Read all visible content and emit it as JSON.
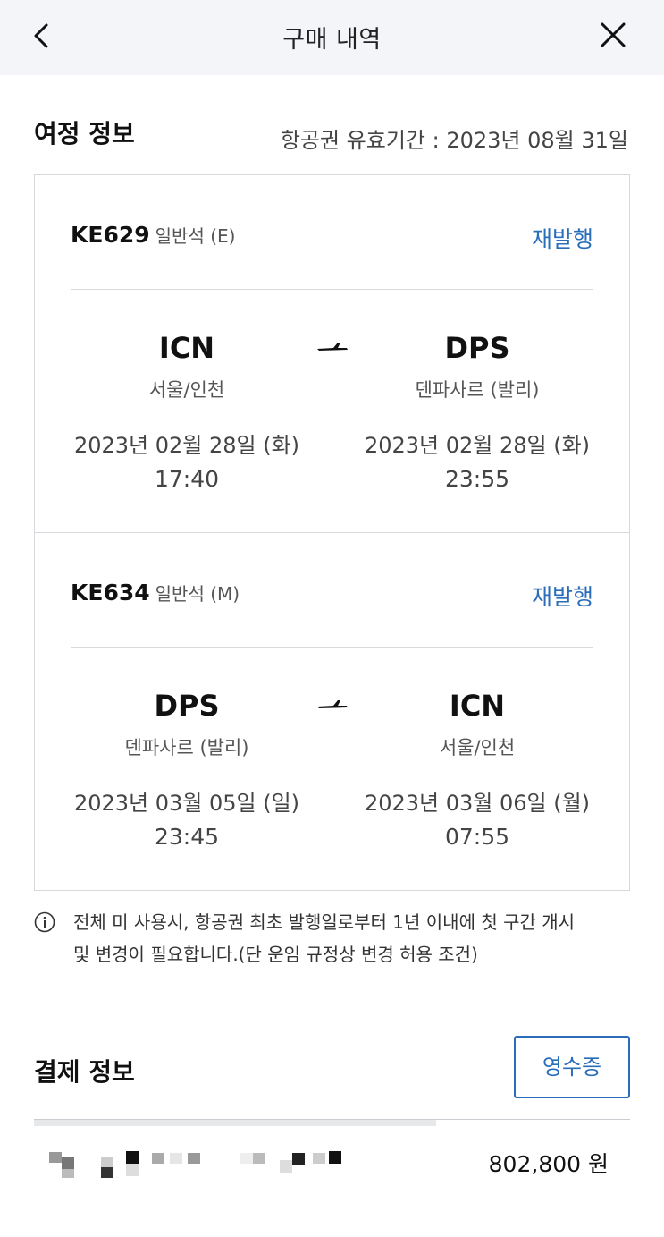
{
  "header": {
    "title": "구매 내역",
    "back_icon": "chevron-left-icon",
    "close_icon": "close-icon"
  },
  "itinerary": {
    "section_title": "여정 정보",
    "validity": "항공권 유효기간 : 2023년 08월 31일",
    "flights": [
      {
        "flight_no": "KE629",
        "cabin": "일반석 (E)",
        "reissue_label": "재발행",
        "departure": {
          "code": "ICN",
          "city": "서울/인천",
          "date": "2023년 02월 28일 (화)",
          "time": "17:40"
        },
        "arrival": {
          "code": "DPS",
          "city": "덴파사르 (발리)",
          "date": "2023년 02월 28일 (화)",
          "time": "23:55"
        }
      },
      {
        "flight_no": "KE634",
        "cabin": "일반석 (M)",
        "reissue_label": "재발행",
        "departure": {
          "code": "DPS",
          "city": "덴파사르 (발리)",
          "date": "2023년 03월 05일 (일)",
          "time": "23:45"
        },
        "arrival": {
          "code": "ICN",
          "city": "서울/인천",
          "date": "2023년 03월 06일 (월)",
          "time": "07:55"
        }
      }
    ],
    "notice_line1": "전체 미 사용시, 항공권 최초 발행일로부터 1년 이내에 첫 구간 개시",
    "notice_line2": "및 변경이 필요합니다.(단 운임 규정상 변경 허용 조건)"
  },
  "payment": {
    "section_title": "결제 정보",
    "receipt_label": "영수증",
    "amount": "802,800 원"
  },
  "colors": {
    "accent": "#2a6db8",
    "header_bg": "#f3f5f8",
    "border": "#d7d9dc"
  }
}
